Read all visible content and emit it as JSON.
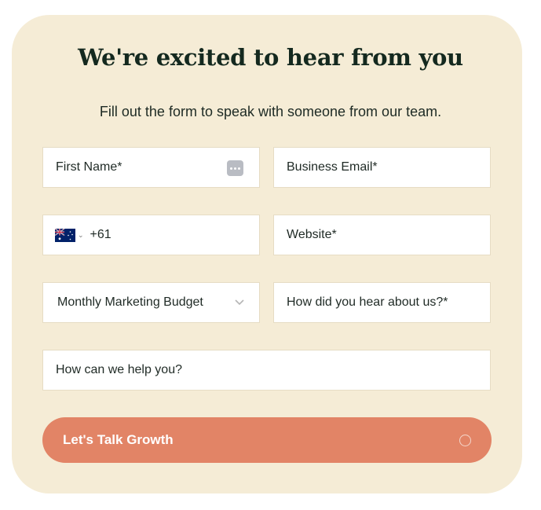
{
  "header": {
    "title": "We're excited to hear from you",
    "subtitle": "Fill out the form to speak with someone from our team."
  },
  "form": {
    "first_name": {
      "placeholder": "First Name*",
      "value": ""
    },
    "business_email": {
      "placeholder": "Business Email*",
      "value": ""
    },
    "phone": {
      "country": "Australia",
      "flag_icon": "australia-flag-icon",
      "dial_code": "+61",
      "value": ""
    },
    "website": {
      "placeholder": "Website*",
      "value": ""
    },
    "budget": {
      "label": "Monthly Marketing Budget",
      "icon": "chevron-down-icon"
    },
    "referral": {
      "placeholder": "How did you hear about us?*",
      "value": ""
    },
    "help": {
      "placeholder": "How can we help you?",
      "value": ""
    },
    "submit_label": "Let's Talk Growth"
  },
  "colors": {
    "card_background": "#f5ecd6",
    "title": "#14291f",
    "button": "#e28466",
    "field_background": "#ffffff"
  }
}
